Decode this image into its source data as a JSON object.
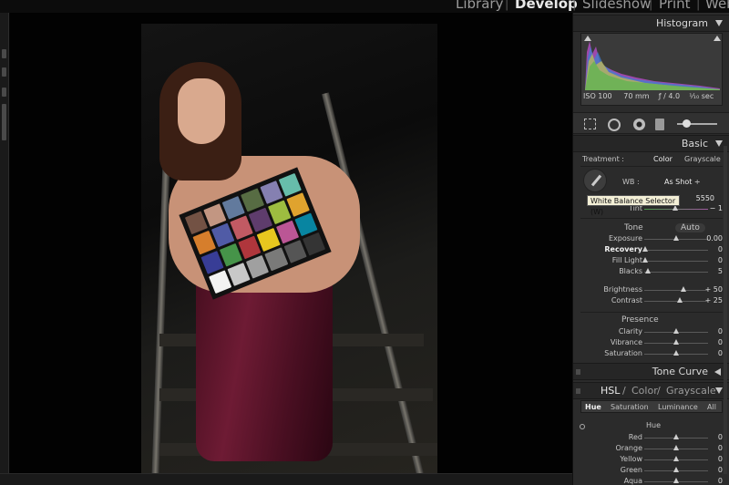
{
  "modules": [
    "Library",
    "Develop",
    "Slideshow",
    "Print",
    "Web"
  ],
  "active_module": "Develop",
  "histogram": {
    "title": "Histogram",
    "iso": "ISO 100",
    "focal": "70 mm",
    "aperture": "ƒ / 4.0",
    "shutter": "¹⁄₁₀ sec"
  },
  "basic": {
    "title": "Basic",
    "treatment_label": "Treatment :",
    "treatment_color": "Color",
    "treatment_grayscale": "Grayscale",
    "wb_label": "WB :",
    "wb_value": "As Shot ÷",
    "temp_value": "5550",
    "tint_label": "Tint",
    "tint_value": "− 1",
    "tooltip": "White Balance Selector (W)",
    "tone_label": "Tone",
    "auto_label": "Auto",
    "presence_label": "Presence",
    "tone_rows": [
      {
        "label": "Exposure",
        "value": "0.00",
        "knob": 0.5
      },
      {
        "label": "Recovery",
        "value": "0",
        "knob": 0.02
      },
      {
        "label": "Fill Light",
        "value": "0",
        "knob": 0.02
      },
      {
        "label": "Blacks",
        "value": "5",
        "knob": 0.05
      }
    ],
    "tone_rows2": [
      {
        "label": "Brightness",
        "value": "+ 50",
        "knob": 0.62
      },
      {
        "label": "Contrast",
        "value": "+ 25",
        "knob": 0.56
      }
    ],
    "presence_rows": [
      {
        "label": "Clarity",
        "value": "0",
        "knob": 0.5
      },
      {
        "label": "Vibrance",
        "value": "0",
        "knob": 0.5
      },
      {
        "label": "Saturation",
        "value": "0",
        "knob": 0.5
      }
    ]
  },
  "tone_curve": {
    "title": "Tone Curve"
  },
  "hsl": {
    "part1": "HSL",
    "part2": "Color",
    "part3": "Grayscale",
    "sep": "/",
    "tabs": [
      "Hue",
      "Saturation",
      "Luminance",
      "All"
    ],
    "hue_label": "Hue",
    "rows": [
      {
        "label": "Red",
        "value": "0",
        "knob": 0.5
      },
      {
        "label": "Orange",
        "value": "0",
        "knob": 0.5
      },
      {
        "label": "Yellow",
        "value": "0",
        "knob": 0.5
      },
      {
        "label": "Green",
        "value": "0",
        "knob": 0.5
      },
      {
        "label": "Aqua",
        "value": "0",
        "knob": 0.5
      }
    ]
  },
  "colors": {
    "panel_bg": "#2b2b2b",
    "dress": "#6e1b34",
    "checker": [
      "#735244",
      "#c29682",
      "#627a9d",
      "#576c43",
      "#8580b1",
      "#67bdaa",
      "#d67e2c",
      "#505ba6",
      "#c15a63",
      "#5e3c6c",
      "#9dbc40",
      "#e0a32e",
      "#383d96",
      "#469449",
      "#af363c",
      "#e7c71f",
      "#bb5695",
      "#0885a1",
      "#f3f3f2",
      "#c8c8c8",
      "#a0a0a0",
      "#7a7a79",
      "#555555",
      "#343434"
    ]
  }
}
